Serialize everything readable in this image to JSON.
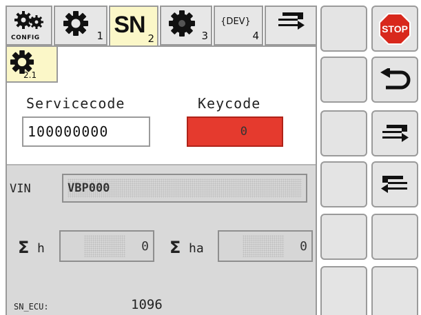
{
  "tabs": [
    {
      "id": "config",
      "label": "CONFIG",
      "subscript": ""
    },
    {
      "id": "settings",
      "label": "",
      "subscript": "1"
    },
    {
      "id": "serial",
      "label": "SN",
      "subscript": "2",
      "active": true
    },
    {
      "id": "gear3",
      "label": "",
      "subscript": "3"
    },
    {
      "id": "dev",
      "label": "{DEV}",
      "subscript": "4"
    },
    {
      "id": "transfer",
      "label": "",
      "subscript": ""
    }
  ],
  "subtab": {
    "subscript": "2.1"
  },
  "service": {
    "servicecode_label": "Servicecode",
    "servicecode_value": "100000000",
    "keycode_label": "Keycode",
    "keycode_value": "0"
  },
  "info": {
    "vin_label": "VIN",
    "vin_value": "VBP000",
    "sum_h_label": "h",
    "sum_h_value": "0",
    "sum_ha_label": "ha",
    "sum_ha_value": "0",
    "sigma": "Σ",
    "sn_ecu_label": "SN_ECU:",
    "sn_ecu_value": "1096"
  },
  "side_buttons": {
    "stop_label": "STOP"
  },
  "colors": {
    "active_tab": "#fbf7c8",
    "keycode_bg": "#e53a2e",
    "stop_red": "#d8281c",
    "panel_grey": "#d9d9d9",
    "button_grey": "#e4e4e4"
  }
}
